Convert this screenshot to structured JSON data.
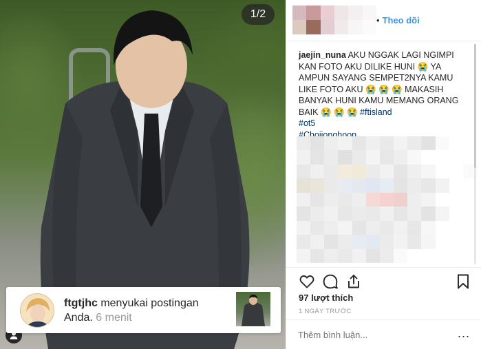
{
  "photo": {
    "counter": "1/2"
  },
  "notification": {
    "username": "ftgtjhc",
    "message": " menyukai postingan Anda.",
    "time": "6 menit"
  },
  "post": {
    "follow_label": "Theo dõi",
    "caption_user": "jaejin_nuna",
    "caption_text": " AKU NGGAK LAGI NGIMPI KAN FOTO AKU DILIKE HUNI 😭  YA AMPUN SAYANG SEMPET2NYA KAMU LIKE FOTO AKU 😭 😭 😭  MAKASIH BANYAK HUNI KAMU MEMANG ORANG BAIK 😭 😭 😭  ",
    "tags": [
      "#ftisland",
      "#ot5",
      "#Choijonghoon"
    ],
    "likes": "97 lượt thích",
    "date": "1 NGÀY TRƯỚC",
    "comment_placeholder": "Thêm bình luận...",
    "more_label": "..."
  },
  "icons": {
    "like": "heart-icon",
    "comment": "comment-icon",
    "share": "share-icon",
    "save": "bookmark-icon",
    "user": "user-icon"
  },
  "colors": {
    "link": "#3897f0",
    "hashtag": "#003569",
    "muted": "#999999",
    "text": "#262626"
  }
}
